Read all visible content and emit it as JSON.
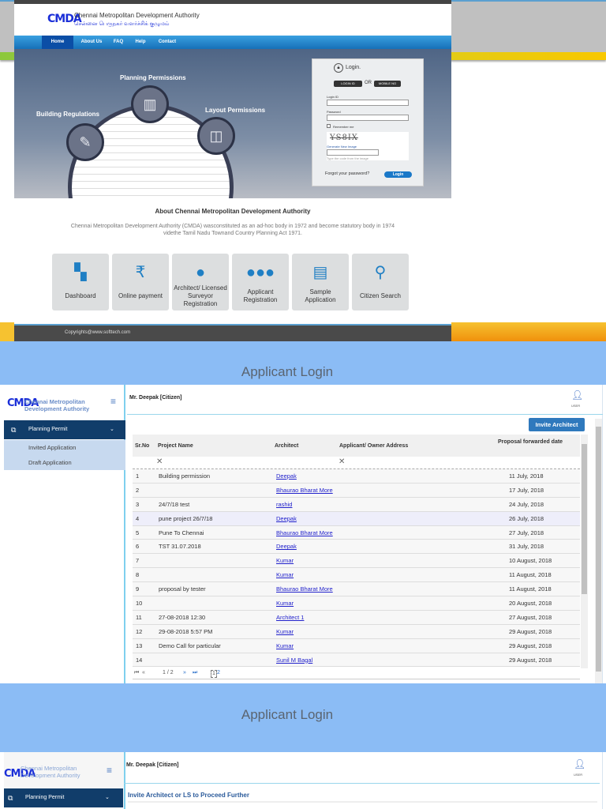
{
  "site": {
    "logo_text": "CMDA",
    "title_en": "Chennai Metropolitan Development Authority",
    "title_ta": "சென்னை பெருநகர் வளர்ச்சிக் குழுமம்",
    "nav": [
      "Home",
      "About Us",
      "FAQ",
      "Help",
      "Contact"
    ],
    "hero": {
      "labels": [
        "Planning Permissions",
        "Building Regulations",
        "Layout Permissions"
      ]
    },
    "login": {
      "title": "Login.",
      "login_id_tab": "LOGIN ID",
      "or": "OR",
      "mobile_tab": "MOBILE NO",
      "login_id_label": "Login ID",
      "password_label": "Password",
      "remember": "Remember me",
      "captcha": "YS8IX",
      "new_image": "Generate New Image",
      "captcha_hint": "Type the code from the image",
      "forgot": "Forgot your password?",
      "login_button": "Login"
    },
    "about_title": "About Chennai Metropolitan Development Authority",
    "about_text": "Chennai Metropolitan Development Authority (CMDA) wasconstituted as an ad-hoc body in 1972 and become statutory body in 1974 videthe Tamil Nadu Townand Country Planning Act 1971.",
    "tiles": [
      {
        "label": "Dashboard",
        "icon": "dashboard-icon"
      },
      {
        "label": "Online payment",
        "icon": "rupee-icon"
      },
      {
        "label": "Architect/ Licensed Surveyor Registration",
        "icon": "person-icon"
      },
      {
        "label": "Applicant Registration",
        "icon": "group-icon"
      },
      {
        "label": "Sample Application",
        "icon": "document-icon"
      },
      {
        "label": "Citizen Search",
        "icon": "search-icon"
      }
    ],
    "footer": "Copyrights@www.softtech.com"
  },
  "band_title": "Applicant Login",
  "app": {
    "org_name": "Chennai Metropolitan Development Authority",
    "user": "Mr. Deepak [Citizen]",
    "user_label": "USER",
    "menu": "Planning Permit",
    "submenu": [
      "Invited Application",
      "Draft Application"
    ],
    "invite_button": "Invite Architect",
    "columns": [
      "Sr.No",
      "Project Name",
      "Architect",
      "Applicant/ Owner Address",
      "Proposal forwarded date"
    ],
    "rows": [
      {
        "no": "1",
        "project": "Building permission",
        "architect": "Deepak",
        "address": "",
        "date": "11 July, 2018"
      },
      {
        "no": "2",
        "project": "",
        "architect": "Bhaurao Bharat More",
        "address": "",
        "date": "17 July, 2018"
      },
      {
        "no": "3",
        "project": "24/7/18 test",
        "architect": "rashid",
        "address": "",
        "date": "24 July, 2018"
      },
      {
        "no": "4",
        "project": "pune project 26/7/18",
        "architect": "Deepak",
        "address": "",
        "date": "26 July, 2018"
      },
      {
        "no": "5",
        "project": "Pune To Chennai",
        "architect": "Bhaurao Bharat More",
        "address": "",
        "date": "27 July, 2018"
      },
      {
        "no": "6",
        "project": "TST 31.07.2018",
        "architect": "Deepak",
        "address": "",
        "date": "31 July, 2018"
      },
      {
        "no": "7",
        "project": "",
        "architect": "Kumar",
        "address": "",
        "date": "10 August, 2018"
      },
      {
        "no": "8",
        "project": "",
        "architect": "Kumar",
        "address": "",
        "date": "11 August, 2018"
      },
      {
        "no": "9",
        "project": "proposal by tester",
        "architect": "Bhaurao Bharat More",
        "address": "",
        "date": "11 August, 2018"
      },
      {
        "no": "10",
        "project": "",
        "architect": "Kumar",
        "address": "",
        "date": "20 August, 2018"
      },
      {
        "no": "11",
        "project": "27-08-2018 12:30",
        "architect": "Architect 1",
        "address": "",
        "date": "27 August, 2018"
      },
      {
        "no": "12",
        "project": "29-08-2018 5:57 PM",
        "architect": "Kumar",
        "address": "",
        "date": "29 August, 2018"
      },
      {
        "no": "13",
        "project": "Demo Call for particular",
        "architect": "Kumar",
        "address": "",
        "date": "29 August, 2018"
      },
      {
        "no": "14",
        "project": "",
        "architect": "Sunil M Bagal",
        "address": "",
        "date": "29 August, 2018"
      }
    ],
    "pager": {
      "page": "1 / 2",
      "pages": [
        "1",
        "2"
      ]
    }
  },
  "app2": {
    "section_title": "Invite Architect or LS to Proceed Further"
  },
  "colors": {
    "nav_blue": "#1670b8",
    "menu_navy": "#113d6a",
    "band": "#8bbcf5",
    "button": "#2f79bd",
    "link": "#2222cc"
  }
}
